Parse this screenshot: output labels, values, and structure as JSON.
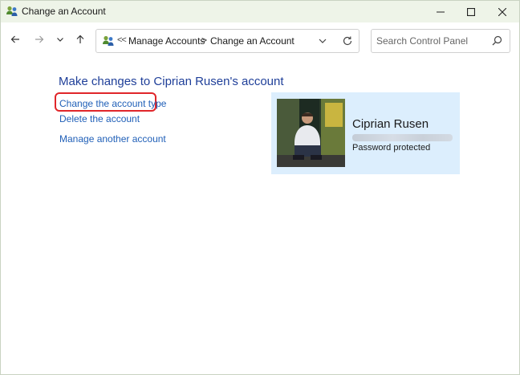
{
  "window": {
    "title": "Change an Account",
    "controls": [
      "minimize-icon",
      "maximize-icon",
      "close-icon"
    ]
  },
  "nav": {
    "back_icon": "arrow-left-icon",
    "forward_icon": "arrow-right-icon",
    "recent_icon": "chevron-down-icon",
    "up_icon": "arrow-up-icon"
  },
  "address": {
    "overflow_marker": "<<",
    "breadcrumbs": [
      "Manage Accounts",
      "Change an Account"
    ],
    "separator": ">"
  },
  "search": {
    "placeholder": "Search Control Panel",
    "value": ""
  },
  "main": {
    "heading": "Make changes to Ciprian Rusen's account",
    "tasks": [
      {
        "label": "Change the account type",
        "highlighted": true
      },
      {
        "label": "Delete the account"
      },
      {
        "label": "Manage another account"
      }
    ]
  },
  "account_card": {
    "name": "Ciprian Rusen",
    "status": "Password protected"
  },
  "colors": {
    "titlebar_bg": "#eef4e8",
    "link": "#2160b8",
    "heading": "#1f3f99",
    "card_bg": "#dceefd",
    "highlight": "#e0262a"
  }
}
